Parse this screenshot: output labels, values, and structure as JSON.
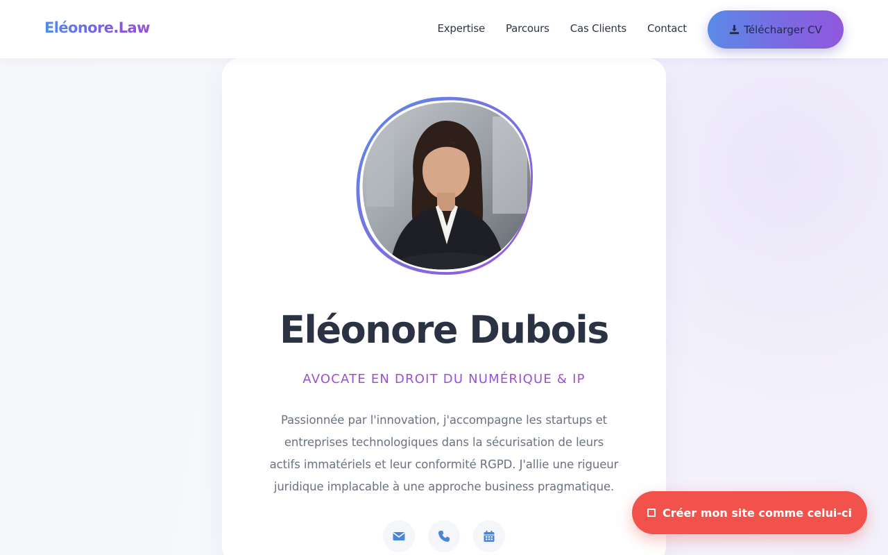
{
  "header": {
    "logo": "Eléonore.Law",
    "nav": [
      "Expertise",
      "Parcours",
      "Cas Clients",
      "Contact"
    ],
    "cv_button": "Télécharger CV",
    "cv_icon": "download-icon"
  },
  "profile": {
    "name": "Eléonore Dubois",
    "role": "AVOCATE EN DROIT DU NUMÉRIQUE & IP",
    "bio": "Passionnée par l'innovation, j'accompagne les startups et entreprises technologiques dans la sécurisation de leurs actifs immatériels et leur conformité RGPD. J'allie une rigueur juridique implacable à une approche business pragmatique.",
    "photo_description": "portrait-photo",
    "contacts": [
      {
        "icon": "email-icon"
      },
      {
        "icon": "phone-icon"
      },
      {
        "icon": "calendar-icon"
      }
    ]
  },
  "cta": {
    "label": "Créer mon site comme celui-ci"
  },
  "colors": {
    "accent_blue": "#4f8ee6",
    "accent_purple": "#9b4fd8",
    "cta_red": "#f2524c",
    "heading": "#2a3244"
  }
}
